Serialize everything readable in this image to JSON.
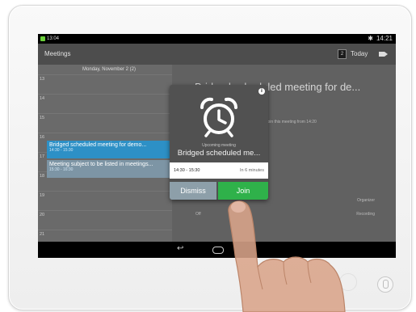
{
  "status_bar": {
    "left": "13:04",
    "time": "14:21"
  },
  "app_bar": {
    "title": "Meetings",
    "calendar_day": "2",
    "today_label": "Today"
  },
  "calendar": {
    "header": "Monday, November 2 (2)",
    "hours": [
      "13",
      "14",
      "15",
      "16",
      "17",
      "18",
      "19",
      "20",
      "21"
    ],
    "events": [
      {
        "title": "Bridged scheduled meeting for demo...",
        "time": "14:30 - 15:30"
      },
      {
        "title": "Meeting subject to be listed in meetings...",
        "time": "15:30 - 16:30"
      }
    ]
  },
  "detail": {
    "title": "Bridged scheduled meeting for de...",
    "join_text": "Join this meeting from 14:20",
    "organizer_label": "Organizer",
    "recording_label": "Recording",
    "recording_value": "Off"
  },
  "dialog": {
    "subtitle": "Upcoming meeting",
    "meeting_name": "Bridged scheduled me...",
    "time_range": "14:30 - 15:30",
    "starts_in": "In 6 minutes",
    "dismiss_label": "Dismiss",
    "join_label": "Join"
  },
  "colors": {
    "join_green": "#2fb14a",
    "dismiss_gray": "#8d9fa9",
    "event_blue": "#2d90c6"
  }
}
